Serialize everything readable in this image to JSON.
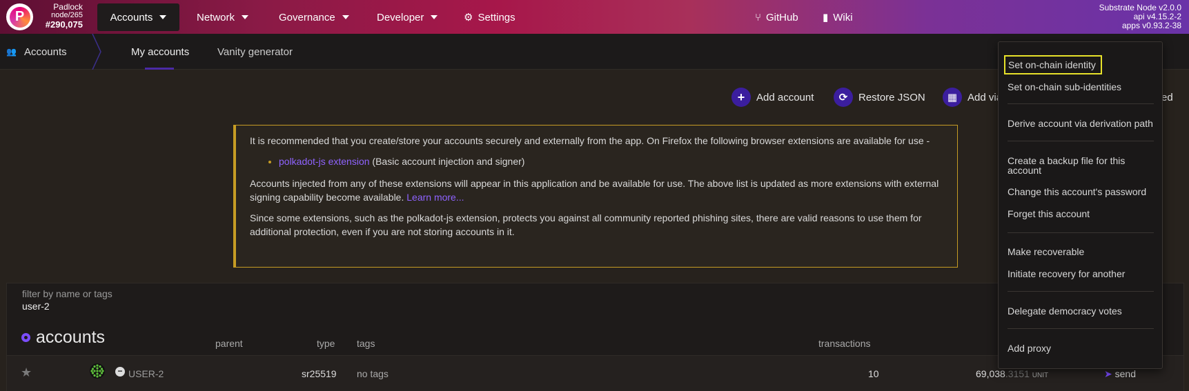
{
  "topbar": {
    "chain_name": "Padlock",
    "node": "node/265",
    "block": "#290,075",
    "nav": [
      {
        "label": "Accounts",
        "active": true
      },
      {
        "label": "Network"
      },
      {
        "label": "Governance"
      },
      {
        "label": "Developer"
      },
      {
        "label": "Settings"
      },
      {
        "label": "GitHub"
      },
      {
        "label": "Wiki"
      }
    ],
    "version_lines": [
      "Substrate Node v2.0.0",
      "api v4.15.2-2",
      "apps v0.93.2-38"
    ]
  },
  "subnav": {
    "section": "Accounts",
    "tabs": [
      "My accounts",
      "Vanity generator"
    ]
  },
  "actions": {
    "add_account": "Add account",
    "restore_json": "Restore JSON",
    "add_via": "Add via",
    "trailing_text": "ed"
  },
  "notice": {
    "p1": "It is recommended that you create/store your accounts securely and externally from the app. On Firefox the following browser extensions are available for use -",
    "ext_link": "polkadot-js extension",
    "ext_desc": " (Basic account injection and signer)",
    "p2": "Accounts injected from any of these extensions will appear in this application and be available for use. The above list is updated as more extensions with external signing capability become available. ",
    "learn_more": "Learn more...",
    "p3": "Since some extensions, such as the polkadot-js extension, protects you against all community reported phishing sites, there are valid reasons to use them for additional protection, even if you are not storing accounts in it."
  },
  "table": {
    "filter_label": "filter by name or tags",
    "filter_value": "user-2",
    "title": "accounts",
    "columns": [
      "parent",
      "type",
      "tags",
      "transactions"
    ],
    "row": {
      "name": "USER-2",
      "type": "sr25519",
      "tags": "no tags",
      "transactions": "10",
      "balance": "69,038",
      "balance_frac": ".3151",
      "unit": "UNIT",
      "send": "send"
    }
  },
  "menu": {
    "items": [
      "Set on-chain identity",
      "Set on-chain sub-identities",
      "Derive account via derivation path",
      "Create a backup file for this account",
      "Change this account's password",
      "Forget this account",
      "Make recoverable",
      "Initiate recovery for another",
      "Delegate democracy votes",
      "Add proxy"
    ],
    "highlight_color": "#e8e22a"
  },
  "colors": {
    "accent": "#7b4dff",
    "button_icon": "#3b1e9e",
    "notice_border": "#c69c24"
  }
}
